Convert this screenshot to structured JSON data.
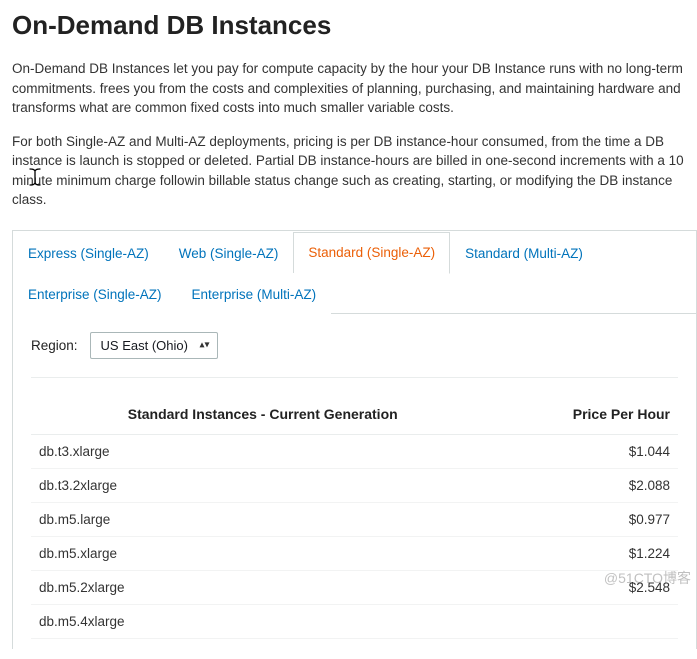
{
  "title": "On-Demand DB Instances",
  "intro": {
    "p1": "On-Demand DB Instances let you pay for compute capacity by the hour your DB Instance runs with no long-term commitments. frees you from the costs and complexities of planning, purchasing, and maintaining hardware and transforms what are common fixed costs into much smaller variable costs.",
    "p2": "For both Single-AZ and Multi-AZ deployments, pricing is per DB instance-hour consumed, from the time a DB instance is launch is stopped or deleted. Partial DB instance-hours are billed in one-second increments with a 10 minute minimum charge followin billable status change such as creating, starting, or modifying the DB instance class."
  },
  "tabs": [
    {
      "label": "Express (Single-AZ)",
      "id": "express-single-az"
    },
    {
      "label": "Web (Single-AZ)",
      "id": "web-single-az"
    },
    {
      "label": "Standard (Single-AZ)",
      "id": "standard-single-az"
    },
    {
      "label": "Standard (Multi-AZ)",
      "id": "standard-multi-az"
    },
    {
      "label": "Enterprise (Single-AZ)",
      "id": "enterprise-single-az"
    },
    {
      "label": "Enterprise (Multi-AZ)",
      "id": "enterprise-multi-az"
    }
  ],
  "active_tab_index": 2,
  "region": {
    "label": "Region:",
    "selected": "US East (Ohio)"
  },
  "table": {
    "headers": {
      "instance": "Standard Instances - Current Generation",
      "price": "Price Per Hour"
    },
    "rows": [
      {
        "name": "db.t3.xlarge",
        "price": "$1.044"
      },
      {
        "name": "db.t3.2xlarge",
        "price": "$2.088"
      },
      {
        "name": "db.m5.large",
        "price": "$0.977"
      },
      {
        "name": "db.m5.xlarge",
        "price": "$1.224"
      },
      {
        "name": "db.m5.2xlarge",
        "price": "$2.548"
      },
      {
        "name": "db.m5.4xlarge",
        "price": ""
      }
    ]
  },
  "watermark": "@51CTO博客"
}
